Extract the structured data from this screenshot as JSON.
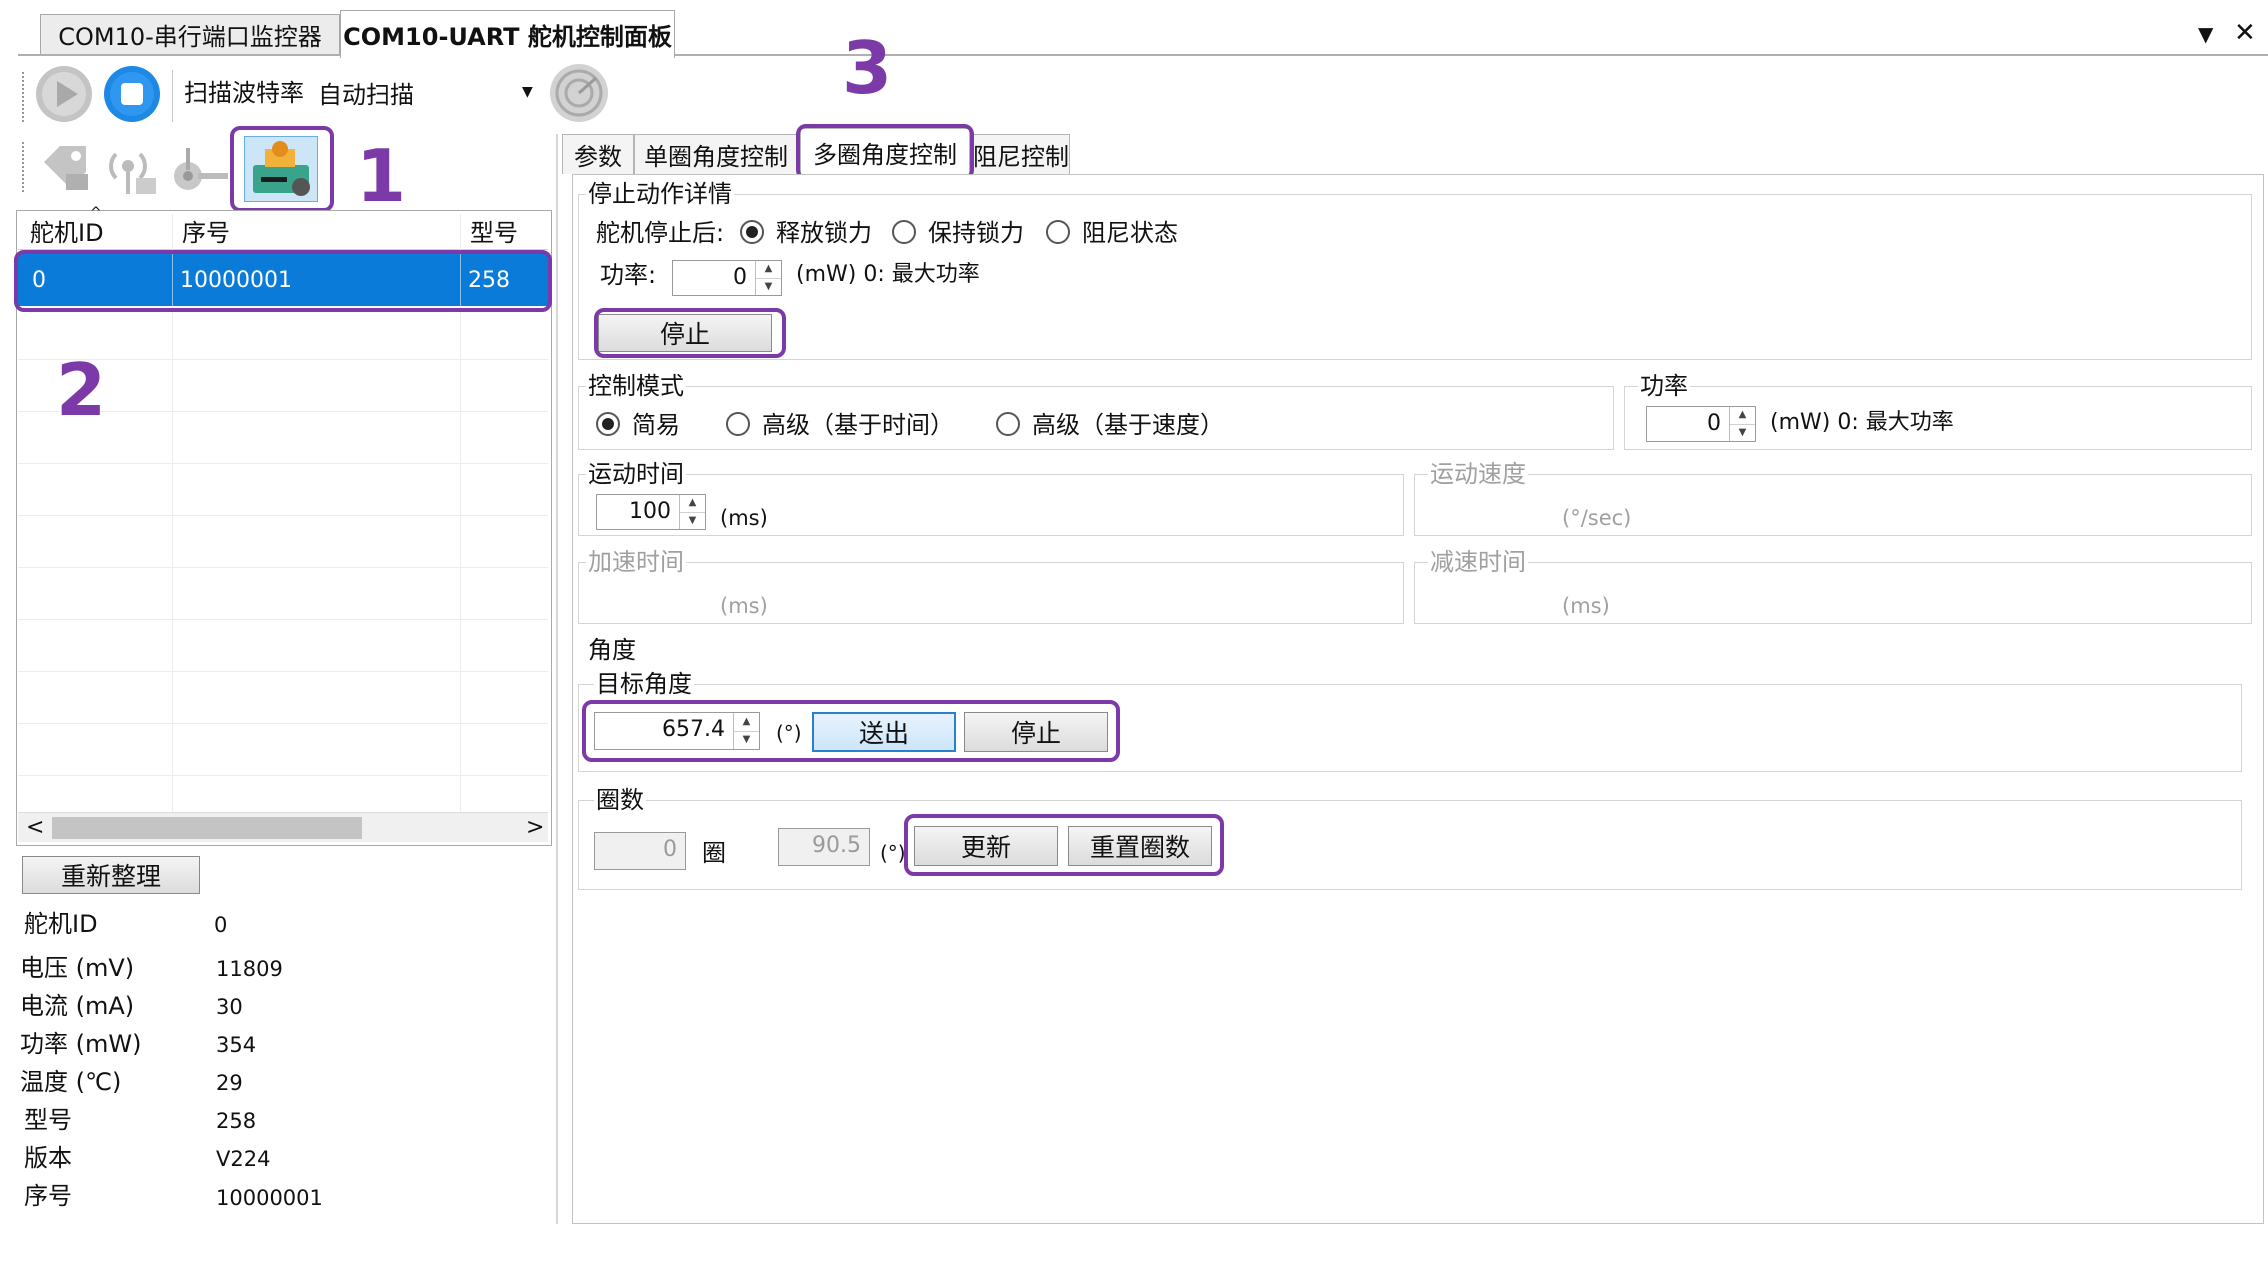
{
  "tabs": [
    {
      "label": "COM10-串行端口监控器"
    },
    {
      "label": "COM10-UART 舵机控制面板"
    }
  ],
  "window_controls": {
    "dropdown": "▼",
    "close": "✕"
  },
  "toolbar": {
    "baud_label": "扫描波特率",
    "baud_value": "自动扫描"
  },
  "device_table": {
    "columns": [
      "舵机ID",
      "序号",
      "型号"
    ],
    "rows": [
      {
        "id": "0",
        "serial": "10000001",
        "model": "258"
      }
    ]
  },
  "rearrange_button": "重新整理",
  "status": {
    "rows": [
      {
        "label": "舵机ID",
        "value": "0"
      },
      {
        "label": "电压 (mV)",
        "value": "11809"
      },
      {
        "label": "电流 (mA)",
        "value": "30"
      },
      {
        "label": "功率 (mW)",
        "value": "354"
      },
      {
        "label": "温度 (℃)",
        "value": "29"
      },
      {
        "label": "型号",
        "value": "258"
      },
      {
        "label": "版本",
        "value": "V224"
      },
      {
        "label": "序号",
        "value": "10000001"
      }
    ]
  },
  "panel_tabs": [
    {
      "label": "参数"
    },
    {
      "label": "单圈角度控制"
    },
    {
      "label": "多圈角度控制"
    },
    {
      "label": "阻尼控制"
    }
  ],
  "stop_details": {
    "group_label": "停止动作详情",
    "after_stop_label": "舵机停止后:",
    "options": [
      "释放锁力",
      "保持锁力",
      "阻尼状态"
    ],
    "selected": 0,
    "power_label": "功率:",
    "power_value": "0",
    "power_hint": "(mW) 0: 最大功率",
    "stop_button": "停止"
  },
  "control_mode": {
    "group_label": "控制模式",
    "options": [
      "简易",
      "高级（基于时间）",
      "高级（基于速度）"
    ],
    "selected": 0
  },
  "power_group": {
    "group_label": "功率",
    "value": "0",
    "hint": "(mW) 0: 最大功率"
  },
  "motion_time": {
    "group_label": "运动时间",
    "value": "100",
    "unit": "(ms)"
  },
  "motion_speed": {
    "group_label": "运动速度",
    "unit": "(°/sec)"
  },
  "accel_time": {
    "group_label": "加速时间",
    "unit": "(ms)"
  },
  "decel_time": {
    "group_label": "减速时间",
    "unit": "(ms)"
  },
  "angle": {
    "group_label": "角度",
    "target_label": "目标角度",
    "target_value": "657.4",
    "unit": "(°)",
    "send_button": "送出",
    "stop_button": "停止"
  },
  "turns": {
    "group_label": "圈数",
    "turns_value": "0",
    "turns_unit": "圈",
    "angle_value": "90.5",
    "angle_unit": "(°)",
    "update_button": "更新",
    "reset_button": "重置圈数"
  },
  "annotations": [
    "1",
    "2",
    "3"
  ],
  "colors": {
    "highlight": "#7b3aa8",
    "selection": "#0a7bd8",
    "accent_blue": "#1e88e5"
  }
}
